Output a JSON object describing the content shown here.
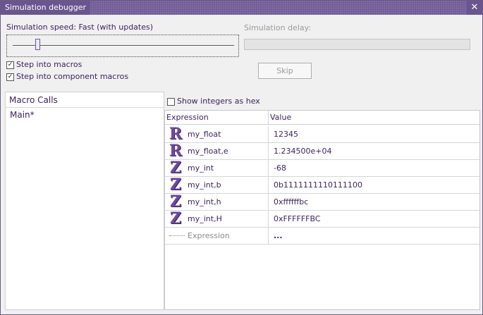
{
  "window": {
    "title": "Simulation debugger",
    "close_glyph": "✕"
  },
  "speed": {
    "label": "Simulation speed: Fast (with updates)",
    "slider_fraction": 0.11
  },
  "delay": {
    "label": "Simulation delay:"
  },
  "options": {
    "step_into_macros": {
      "label": "Step into macros",
      "checked": true
    },
    "step_into_component_macros": {
      "label": "Step into component macros",
      "checked": true
    },
    "show_hex": {
      "label": "Show integers as hex",
      "checked": false
    }
  },
  "skip_button": {
    "label": "Skip"
  },
  "macro_calls": {
    "header": "Macro Calls",
    "items": [
      "Main*"
    ]
  },
  "watch": {
    "columns": [
      "Expression",
      "Value"
    ],
    "rows": [
      {
        "type": "R",
        "expr": "my_float",
        "value": "12345"
      },
      {
        "type": "R",
        "expr": "my_float,e",
        "value": "1.234500e+04"
      },
      {
        "type": "Z",
        "expr": "my_int",
        "value": "-68"
      },
      {
        "type": "Z",
        "expr": "my_int,b",
        "value": "0b1111111110111100"
      },
      {
        "type": "Z",
        "expr": "my_int,h",
        "value": "0xffffffbc"
      },
      {
        "type": "Z",
        "expr": "my_int,H",
        "value": "0xFFFFFFBC"
      }
    ],
    "new_row": {
      "expr_placeholder": "Expression",
      "value": "..."
    }
  },
  "colors": {
    "accent": "#6a558f",
    "text": "#3a1f5a",
    "icon": "#6e4aa1"
  }
}
